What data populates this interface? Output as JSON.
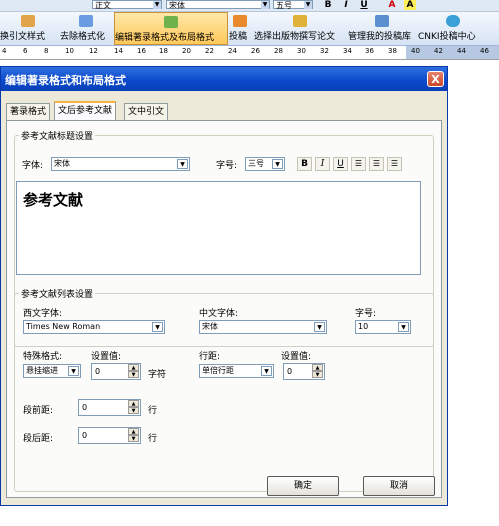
{
  "toolbar": {
    "style_combo": "正文",
    "font_combo": "宋体",
    "size_combo": "五号",
    "bold": "B",
    "italic": "I",
    "underline": "U",
    "font_color": "A",
    "highlight": "A"
  },
  "addin_bar": {
    "items": [
      {
        "label": "换引文样式"
      },
      {
        "label": "去除格式化"
      },
      {
        "label": "编辑著录格式及布局格式"
      },
      {
        "label": "投稿"
      },
      {
        "label": "选择出版物撰写论文"
      },
      {
        "label": "管理我的投稿库"
      },
      {
        "label": "CNKI投稿中心"
      }
    ]
  },
  "ruler": {
    "ticks": [
      "4",
      "6",
      "8",
      "10",
      "12",
      "14",
      "16",
      "18",
      "20",
      "22",
      "24",
      "26",
      "28",
      "30",
      "32",
      "34",
      "36",
      "38",
      "40",
      "42",
      "44",
      "46"
    ]
  },
  "dialog": {
    "title": "编辑著录格式和布局格式",
    "close": "X",
    "tabs": [
      "著录格式",
      "文后参考文献",
      "文中引文"
    ],
    "heading_group": {
      "legend": "参考文献标题设置",
      "font_label": "字体:",
      "font_value": "宋体",
      "size_label": "字号:",
      "size_value": "三号",
      "bold": "B",
      "italic": "I",
      "underline": "U",
      "preview_text": "参考文献"
    },
    "list_group": {
      "legend": "参考文献列表设置",
      "western_font_label": "西文字体:",
      "western_font_value": "Times New Roman",
      "chinese_font_label": "中文字体:",
      "chinese_font_value": "宋体",
      "size_label": "字号:",
      "size_value": "10",
      "special_format_label": "特殊格式:",
      "special_format_value": "悬挂缩进",
      "setting_label": "设置值:",
      "setting_value": "0",
      "setting_unit": "字符",
      "line_spacing_label": "行距:",
      "line_spacing_value": "单倍行距",
      "line_setting_label": "设置值:",
      "line_setting_value": "0",
      "before_label": "段前距:",
      "before_value": "0",
      "before_unit": "行",
      "after_label": "段后距:",
      "after_value": "0",
      "after_unit": "行"
    },
    "ok": "确定",
    "cancel": "取消"
  }
}
